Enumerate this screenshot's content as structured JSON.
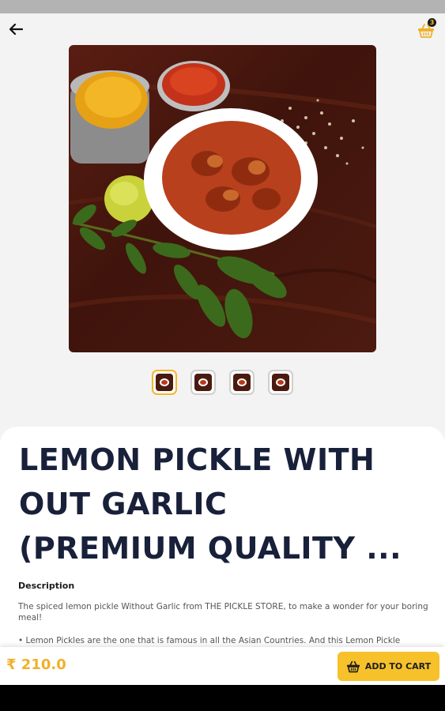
{
  "header": {
    "back_icon": "arrow-left-icon",
    "cart_icon": "basket-icon",
    "cart_count": "3"
  },
  "gallery": {
    "main_image": "lemon pickle in white bowl with spices",
    "thumbnails": [
      "thumb-1",
      "thumb-2",
      "thumb-3",
      "thumb-4"
    ],
    "active_index": 0
  },
  "product": {
    "title": "LEMON PICKLE WITH\nOUT GARLIC\n(PREMIUM QUALITY ...",
    "description_heading": "Description",
    "description": "The spiced lemon pickle Without Garlic from THE PICKLE STORE, to make a wonder for your boring meal!",
    "bullet": "• Lemon Pickles are the one that is famous in all the Asian Countries. And this Lemon Pickle"
  },
  "footer": {
    "price": "₹ 210.0",
    "add_to_cart_label": "ADD TO CART"
  },
  "colors": {
    "accent": "#f6c12a",
    "price": "#f0b02a",
    "title": "#18203a"
  }
}
